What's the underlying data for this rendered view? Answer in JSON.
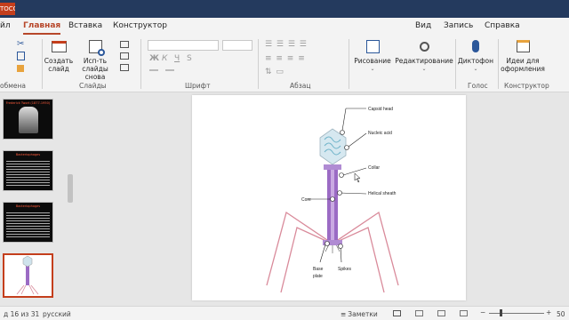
{
  "title_bar": {
    "document_label": "ТОСОМ"
  },
  "tabs": [
    {
      "label": "йл"
    },
    {
      "label": "Главная"
    },
    {
      "label": "Вставка"
    },
    {
      "label": "Конструктор"
    },
    {
      "label": "Вид"
    },
    {
      "label": "Запись"
    },
    {
      "label": "Справка"
    }
  ],
  "ribbon": {
    "clipboard": {
      "group_label": "обмена"
    },
    "slides": {
      "new_slide": "Создать слайд",
      "reuse_slides": "Исп-ть слайды снова",
      "group_label": "Слайды"
    },
    "font": {
      "bold": "Ж",
      "italic": "К",
      "underline": "Ч",
      "strike": "S",
      "group_label": "Шрифт"
    },
    "paragraph": {
      "group_label": "Абзац"
    },
    "drawing": {
      "label": "Рисование"
    },
    "editing": {
      "label": "Редактирование"
    },
    "voice": {
      "dictate": "Диктофон",
      "group_label": "Голос"
    },
    "designer": {
      "ideas": "Идеи для оформления",
      "group_label": "Конструктор"
    }
  },
  "thumbnails": [
    {
      "number": "",
      "title": "Frederick Twort (1877-1950)"
    },
    {
      "number": "",
      "title": "Bacteriophages"
    },
    {
      "number": "",
      "title": "Bacteriophages"
    },
    {
      "number": "",
      "title": ""
    }
  ],
  "slide": {
    "labels": {
      "capsid_head": "Capsid head",
      "nucleic_acid": "Nucleic acid",
      "collar": "Collar",
      "helical_sheath": "Helical sheath",
      "core": "Core",
      "base_plate_line1": "Base",
      "base_plate_line2": "plate",
      "spikes": "Spikes"
    }
  },
  "status_bar": {
    "slide_counter": "д 16 из 31",
    "language": "русский",
    "notes": "Заметки",
    "zoom": "50"
  },
  "colors": {
    "accent": "#b7472a",
    "title_bar": "#243a5e",
    "tail": "#9b6bc4",
    "legs": "#d98a9a"
  }
}
